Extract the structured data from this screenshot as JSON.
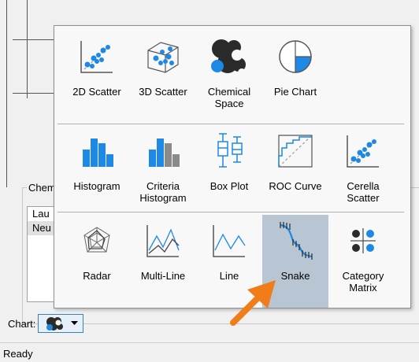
{
  "background": {
    "group_label": "Chem",
    "list_items": [
      "Lau",
      "Neu"
    ],
    "chart_label": "Chart:",
    "status": "Ready"
  },
  "menu": {
    "rows": [
      [
        {
          "label": "2D Scatter",
          "icon": "2d-scatter-icon"
        },
        {
          "label": "3D Scatter",
          "icon": "3d-scatter-icon"
        },
        {
          "label": "Chemical Space",
          "icon": "chemical-space-icon"
        },
        {
          "label": "Pie Chart",
          "icon": "pie-chart-icon"
        }
      ],
      [
        {
          "label": "Histogram",
          "icon": "histogram-icon"
        },
        {
          "label": "Criteria Histogram",
          "icon": "criteria-histogram-icon"
        },
        {
          "label": "Box Plot",
          "icon": "box-plot-icon"
        },
        {
          "label": "ROC Curve",
          "icon": "roc-curve-icon"
        },
        {
          "label": "Cerella Scatter",
          "icon": "cerella-scatter-icon"
        }
      ],
      [
        {
          "label": "Radar",
          "icon": "radar-icon"
        },
        {
          "label": "Multi-Line",
          "icon": "multi-line-icon"
        },
        {
          "label": "Line",
          "icon": "line-icon"
        },
        {
          "label": "Snake",
          "icon": "snake-icon",
          "selected": true
        },
        {
          "label": "Category Matrix",
          "icon": "category-matrix-icon"
        }
      ]
    ]
  },
  "colors": {
    "accent": "#1e88e5",
    "dark": "#2b2b2b",
    "grey": "#8a8a8a",
    "arrow": "#f07d1a",
    "selected_bg": "#b8c6d3"
  }
}
